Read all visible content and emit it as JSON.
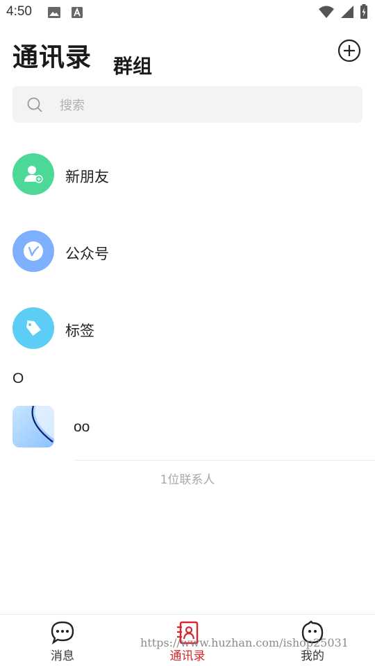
{
  "status_bar": {
    "time": "4:50",
    "left_icons": [
      "image-icon",
      "a-icon"
    ],
    "right_icons": [
      "wifi-icon",
      "signal-icon",
      "battery-icon"
    ]
  },
  "header": {
    "title": "通讯录",
    "subtitle": "群组",
    "add_icon": "plus-circle-icon"
  },
  "search": {
    "placeholder": "搜索",
    "icon": "search-icon"
  },
  "menu_items": [
    {
      "label": "新朋友",
      "icon": "add-friend-icon",
      "color": "#4cd896"
    },
    {
      "label": "公众号",
      "icon": "official-account-icon",
      "color": "#7fb0ff"
    },
    {
      "label": "标签",
      "icon": "tag-icon",
      "color": "#5ccdf4"
    }
  ],
  "contacts": {
    "section_letter": "O",
    "items": [
      {
        "name": "oo"
      }
    ],
    "count_text": "1位联系人"
  },
  "tab_bar": {
    "tabs": [
      {
        "label": "消息",
        "icon": "chat-bubble-icon",
        "active": false
      },
      {
        "label": "通讯录",
        "icon": "contacts-icon",
        "active": true
      },
      {
        "label": "我的",
        "icon": "profile-face-icon",
        "active": false
      }
    ],
    "active_color": "#d9262c"
  },
  "watermark": "https://www.huzhan.com/ishop25031"
}
